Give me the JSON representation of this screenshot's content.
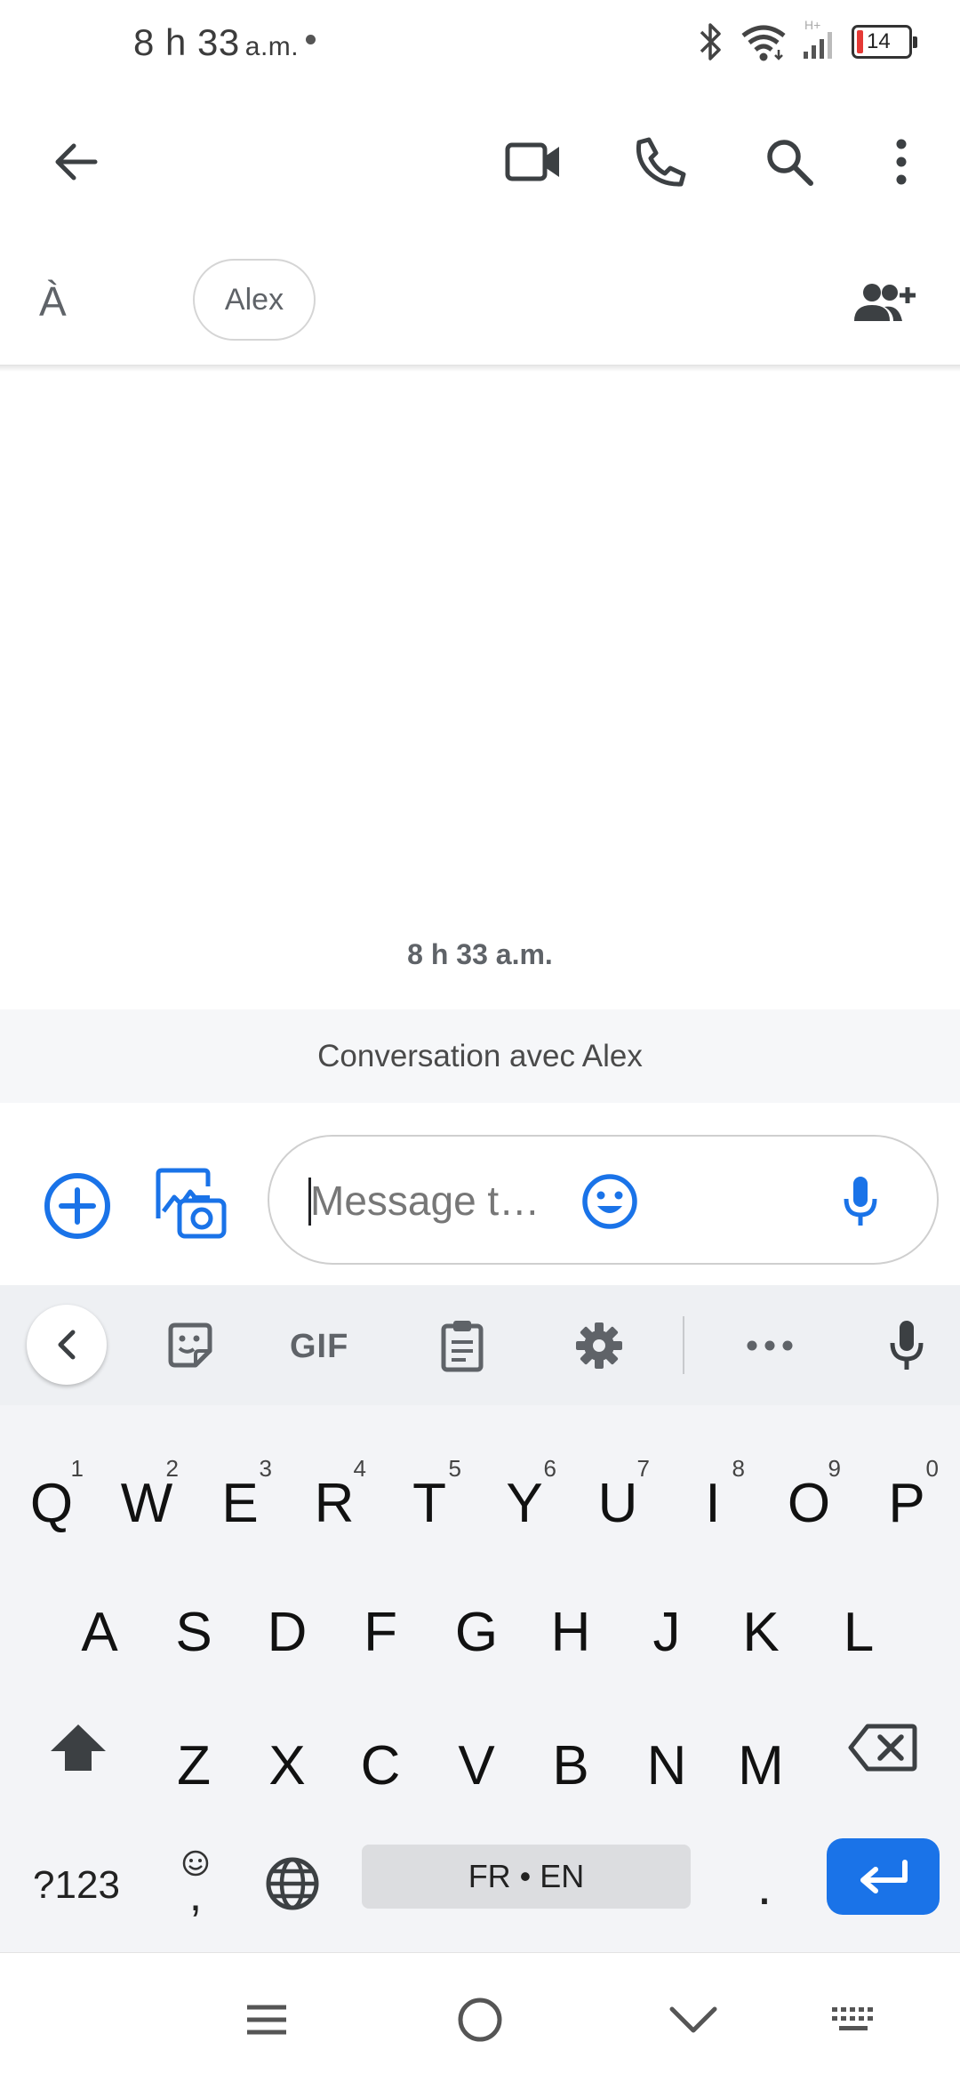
{
  "status_bar": {
    "time": "8 h 33",
    "ampm": "a.m.",
    "battery_level": "14",
    "network_type": "H+"
  },
  "app_bar": {
    "icons": [
      "back-arrow-icon",
      "video-call-icon",
      "phone-icon",
      "search-icon",
      "more-vert-icon"
    ]
  },
  "recipient": {
    "to_label": "À",
    "chip_name": "Alex"
  },
  "conversation": {
    "timestamp": "8 h 33 a.m.",
    "banner": "Conversation avec Alex"
  },
  "compose": {
    "placeholder": "Message t…",
    "value": ""
  },
  "keyboard": {
    "toolbar": {
      "gif_label": "GIF"
    },
    "row1": [
      {
        "key": "Q",
        "hint": "1"
      },
      {
        "key": "W",
        "hint": "2"
      },
      {
        "key": "E",
        "hint": "3"
      },
      {
        "key": "R",
        "hint": "4"
      },
      {
        "key": "T",
        "hint": "5"
      },
      {
        "key": "Y",
        "hint": "6"
      },
      {
        "key": "U",
        "hint": "7"
      },
      {
        "key": "I",
        "hint": "8"
      },
      {
        "key": "O",
        "hint": "9"
      },
      {
        "key": "P",
        "hint": "0"
      }
    ],
    "row2": [
      "A",
      "S",
      "D",
      "F",
      "G",
      "H",
      "J",
      "K",
      "L"
    ],
    "row3": [
      "Z",
      "X",
      "C",
      "V",
      "B",
      "N",
      "M"
    ],
    "symbols_label": "?123",
    "comma_label": ",",
    "space_label": "FR • EN",
    "period_label": ".",
    "accent_color": "#1a73e8"
  }
}
